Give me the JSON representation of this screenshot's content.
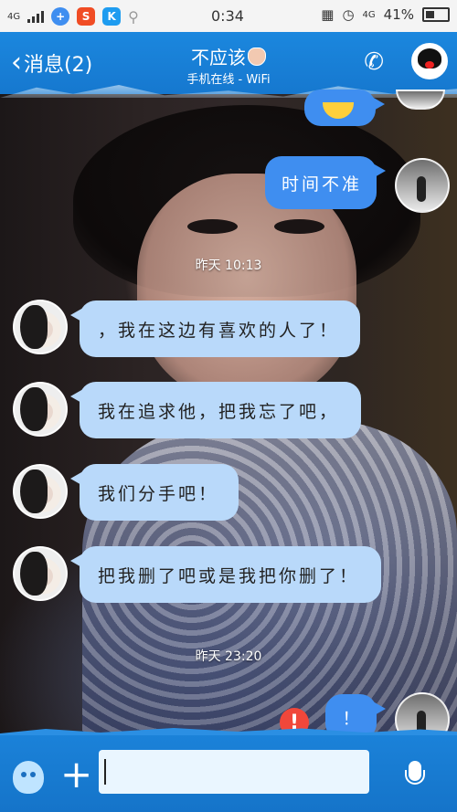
{
  "status_bar": {
    "network": "4G",
    "time": "0:34",
    "network_right": "4G",
    "battery": "41%",
    "app_icons": [
      "badge-app-icon",
      "s-app-icon",
      "k-app-icon",
      "search-icon"
    ]
  },
  "header": {
    "back_label": "消息(2)",
    "title": "不应该",
    "subtitle": "手机在线 - WiFi"
  },
  "chat": {
    "messages": [
      {
        "side": "right",
        "text": "时间不准"
      },
      {
        "side": "left",
        "text": "，我在这边有喜欢的人了！"
      },
      {
        "side": "left",
        "text": "我在追求他，把我忘了吧，"
      },
      {
        "side": "left",
        "text": "我们分手吧！"
      },
      {
        "side": "left",
        "text": "把我删了吧或是我把你删了！"
      },
      {
        "side": "right",
        "text": "！",
        "failed": true
      }
    ],
    "timestamps": [
      "昨天 10:13",
      "昨天 23:20"
    ],
    "error_mark": "!"
  },
  "input_bar": {
    "value": ""
  },
  "colors": {
    "header_blue": "#1b87de",
    "bubble_left": "#b9d9fa",
    "bubble_right": "#3f8ef0",
    "error_red": "#f0473a"
  }
}
